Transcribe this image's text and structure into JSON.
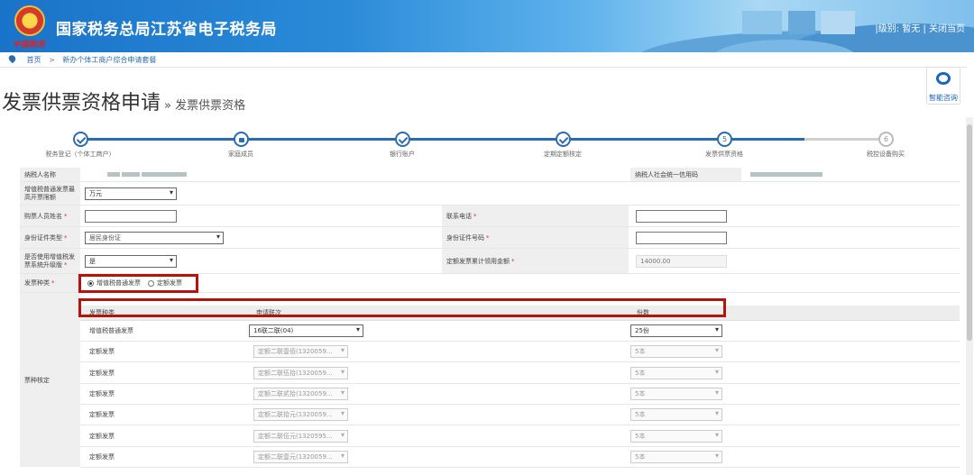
{
  "header": {
    "site_title": "国家税务总局江苏省电子税务局",
    "emblem_text": "中国税务",
    "links": "|级别: 暂无 | 关闭当页"
  },
  "breadcrumb": {
    "home": "首页",
    "separator": ">",
    "current": "新办个体工商户综合申请套餐"
  },
  "help_button": "智能咨询",
  "page": {
    "title": "发票供票资格申请",
    "subtitle": "» 发票供票资格"
  },
  "steps": [
    {
      "label": "税务登记（个体工商户）",
      "status": "done",
      "num": ""
    },
    {
      "label": "家庭成员",
      "status": "locked",
      "num": ""
    },
    {
      "label": "银行账户",
      "status": "done",
      "num": ""
    },
    {
      "label": "定期定额核定",
      "status": "done",
      "num": ""
    },
    {
      "label": "发票供票资格",
      "status": "current",
      "num": "5"
    },
    {
      "label": "税控设备购买",
      "status": "pending",
      "num": "6"
    }
  ],
  "form": {
    "taxpayer_name_label": "纳税人名称",
    "credit_code_label": "纳税人社会统一信用码",
    "max_amount_label": "增值税普通发票最高开票限额",
    "max_amount_value": "万元",
    "buyer_name_label": "购票人员姓名",
    "phone_label": "联系电话",
    "id_type_label": "身份证件类型",
    "id_type_value": "居民身份证",
    "id_number_label": "身份证件号码",
    "use_system_label": "是否使用增值税发票系统升级版",
    "use_system_value": "是",
    "cumulative_label": "定额发票累计领用金额",
    "cumulative_value": "14000.00",
    "invoice_kind_label": "发票种类",
    "invoice_kind_options": [
      "增值税普通发票",
      "定额发票"
    ],
    "ticket_section_label": "票种核定",
    "required_mark": "*"
  },
  "ticket_table": {
    "headers": [
      "发票种类",
      "申请联次",
      "份数"
    ],
    "rows": [
      {
        "kind": "增值税普通发票",
        "copies": "16联二联(04)",
        "qty": "25份",
        "enabled": true
      },
      {
        "kind": "定额发票",
        "copies": "定额二联壹佰(1320059...",
        "qty": "5本",
        "enabled": false
      },
      {
        "kind": "定额发票",
        "copies": "定额二联伍拾(1320059...",
        "qty": "5本",
        "enabled": false
      },
      {
        "kind": "定额发票",
        "copies": "定额二联贰拾(1320059...",
        "qty": "5本",
        "enabled": false
      },
      {
        "kind": "定额发票",
        "copies": "定额二联拾元(1320059...",
        "qty": "5本",
        "enabled": false
      },
      {
        "kind": "定额发票",
        "copies": "定额二联伍元(1320595...",
        "qty": "5本",
        "enabled": false
      },
      {
        "kind": "定额发票",
        "copies": "定额二联壹元(1320059...",
        "qty": "5本",
        "enabled": false
      }
    ]
  },
  "colors": {
    "brand_blue": "#2a6cb0",
    "highlight_red": "#b4140c",
    "required_red": "#dd3333"
  }
}
